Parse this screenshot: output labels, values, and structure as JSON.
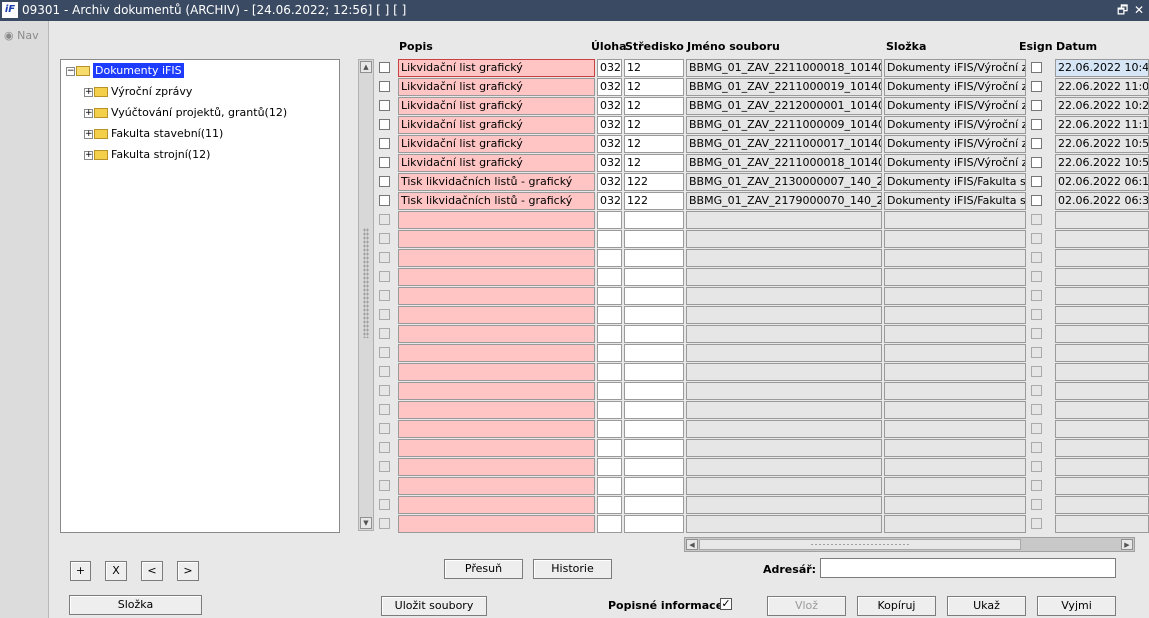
{
  "window": {
    "title": "09301 - Archiv dokumentů (ARCHIV) - [24.06.2022; 12:56]  [ ] [ ]",
    "logo": "iF",
    "restore_glyph": "🗗",
    "close_glyph": "✕"
  },
  "nav": {
    "label": "Nav"
  },
  "tree": {
    "root": "Dokumenty iFIS",
    "children": [
      "Výroční zprávy",
      "Vyúčtování projektů, grantů(12)",
      "Fakulta stavební(11)",
      "Fakulta strojní(12)"
    ]
  },
  "table": {
    "headers": {
      "popis": "Popis",
      "uloha": "Úloha",
      "stredisko": "Středisko",
      "jmeno": "Jméno souboru",
      "slozka": "Složka",
      "esign": "Esign",
      "datum": "Datum"
    },
    "rows": [
      {
        "popis": "Likvidační list grafický",
        "uloha": "032",
        "stredisko": "12",
        "jmeno": "BBMG_01_ZAV_2211000018_10140_2",
        "slozka": "Dokumenty iFIS/Výroční zprá",
        "datum": "22.06.2022 10:4"
      },
      {
        "popis": "Likvidační list grafický",
        "uloha": "032",
        "stredisko": "12",
        "jmeno": "BBMG_01_ZAV_2211000019_10140_2",
        "slozka": "Dokumenty iFIS/Výroční zprá",
        "datum": "22.06.2022 11:0"
      },
      {
        "popis": "Likvidační list grafický",
        "uloha": "032",
        "stredisko": "12",
        "jmeno": "BBMG_01_ZAV_2212000001_10140_2",
        "slozka": "Dokumenty iFIS/Výroční zprá",
        "datum": "22.06.2022 10:2"
      },
      {
        "popis": "Likvidační list grafický",
        "uloha": "032",
        "stredisko": "12",
        "jmeno": "BBMG_01_ZAV_2211000009_10140_2",
        "slozka": "Dokumenty iFIS/Výroční zprá",
        "datum": "22.06.2022 11:1"
      },
      {
        "popis": "Likvidační list grafický",
        "uloha": "032",
        "stredisko": "12",
        "jmeno": "BBMG_01_ZAV_2211000017_10140_2",
        "slozka": "Dokumenty iFIS/Výroční zprá",
        "datum": "22.06.2022 10:5"
      },
      {
        "popis": "Likvidační list grafický",
        "uloha": "032",
        "stredisko": "12",
        "jmeno": "BBMG_01_ZAV_2211000018_10140_2",
        "slozka": "Dokumenty iFIS/Výroční zprá",
        "datum": "22.06.2022 10:5"
      },
      {
        "popis": "Tisk likvidačních listů - grafický",
        "uloha": "032",
        "stredisko": "122",
        "jmeno": "BBMG_01_ZAV_2130000007_140_220",
        "slozka": "Dokumenty iFIS/Fakulta strojn",
        "datum": "02.06.2022 06:1"
      },
      {
        "popis": "Tisk likvidačních listů - grafický",
        "uloha": "032",
        "stredisko": "122",
        "jmeno": "BBMG_01_ZAV_2179000070_140_220",
        "slozka": "Dokumenty iFIS/Fakulta strojn",
        "datum": "02.06.2022 06:3"
      }
    ],
    "empty_rows": 17
  },
  "tree_buttons": {
    "add": "+",
    "remove": "X",
    "prev": "<",
    "next": ">"
  },
  "buttons": {
    "slozka": "Složka",
    "ulozit": "Uložit soubory",
    "presun": "Přesuň",
    "historie": "Historie",
    "vloz": "Vlož",
    "kopiruj": "Kopíruj",
    "ukaz": "Ukaž",
    "vyjmi": "Vyjmi"
  },
  "adresar": {
    "label": "Adresář:",
    "value": ""
  },
  "popisne": {
    "label": "Popisné informace",
    "checked": true,
    "check_glyph": "✓"
  },
  "colors": {
    "title_bar": "#3a4a62",
    "popis_cell": "#ffc4c4",
    "selected_node": "#1e3cff"
  }
}
